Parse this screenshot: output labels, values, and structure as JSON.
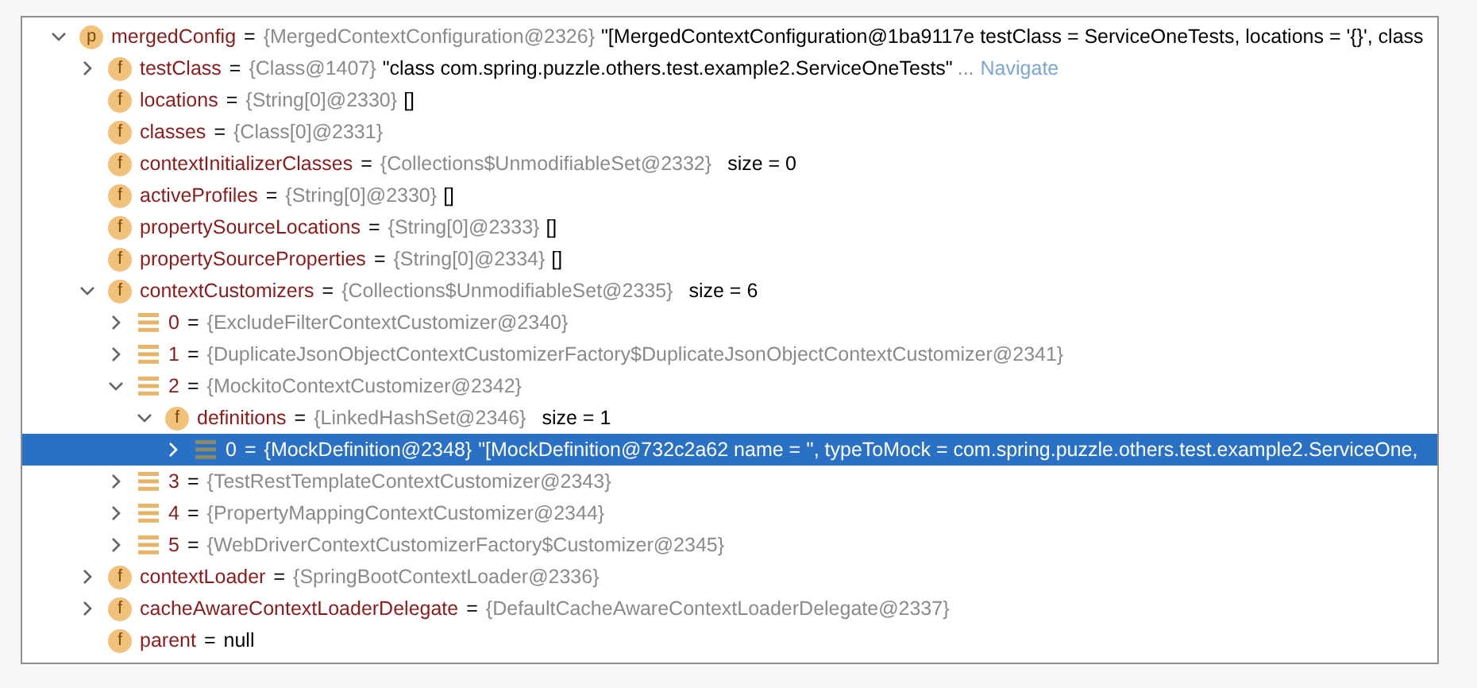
{
  "variables": [
    {
      "kind": "property",
      "badge": "p",
      "name": "mergedConfig",
      "assign": "=",
      "type": "{MergedContextConfiguration@2326}",
      "value": "\"[MergedContextConfiguration@1ba9117e testClass = ServiceOneTests, locations = '{}', class",
      "expanded": true,
      "selected": false,
      "children": [
        {
          "kind": "field",
          "badge": "f",
          "name": "testClass",
          "assign": "=",
          "type": "{Class@1407}",
          "value": "\"class com.spring.puzzle.others.test.example2.ServiceOneTests\"",
          "more": "...",
          "link": "Navigate",
          "expanded": false,
          "selected": false
        },
        {
          "kind": "field",
          "badge": "f",
          "name": "locations",
          "assign": "=",
          "type": "{String[0]@2330}",
          "value": "[]",
          "selected": false
        },
        {
          "kind": "field",
          "badge": "f",
          "name": "classes",
          "assign": "=",
          "type": "{Class[0]@2331}",
          "selected": false
        },
        {
          "kind": "field",
          "badge": "f",
          "name": "contextInitializerClasses",
          "assign": "=",
          "type": "{Collections$UnmodifiableSet@2332}",
          "size": "size = 0",
          "selected": false
        },
        {
          "kind": "field",
          "badge": "f",
          "name": "activeProfiles",
          "assign": "=",
          "type": "{String[0]@2330}",
          "value": "[]",
          "selected": false
        },
        {
          "kind": "field",
          "badge": "f",
          "name": "propertySourceLocations",
          "assign": "=",
          "type": "{String[0]@2333}",
          "value": "[]",
          "selected": false
        },
        {
          "kind": "field",
          "badge": "f",
          "name": "propertySourceProperties",
          "assign": "=",
          "type": "{String[0]@2334}",
          "value": "[]",
          "selected": false
        },
        {
          "kind": "field",
          "badge": "f",
          "name": "contextCustomizers",
          "assign": "=",
          "type": "{Collections$UnmodifiableSet@2335}",
          "size": "size = 6",
          "expanded": true,
          "selected": false,
          "children": [
            {
              "kind": "element",
              "name": "0",
              "assign": "=",
              "type": "{ExcludeFilterContextCustomizer@2340}",
              "expanded": false,
              "selected": false
            },
            {
              "kind": "element",
              "name": "1",
              "assign": "=",
              "type": "{DuplicateJsonObjectContextCustomizerFactory$DuplicateJsonObjectContextCustomizer@2341}",
              "expanded": false,
              "selected": false
            },
            {
              "kind": "element",
              "name": "2",
              "assign": "=",
              "type": "{MockitoContextCustomizer@2342}",
              "expanded": true,
              "selected": false,
              "children": [
                {
                  "kind": "field",
                  "badge": "f",
                  "name": "definitions",
                  "assign": "=",
                  "type": "{LinkedHashSet@2346}",
                  "size": "size = 1",
                  "expanded": true,
                  "selected": false,
                  "children": [
                    {
                      "kind": "element",
                      "name": "0",
                      "assign": "=",
                      "type": "{MockDefinition@2348}",
                      "value": "\"[MockDefinition@732c2a62 name = '', typeToMock = com.spring.puzzle.others.test.example2.ServiceOne,",
                      "expanded": false,
                      "selected": true
                    }
                  ]
                }
              ]
            },
            {
              "kind": "element",
              "name": "3",
              "assign": "=",
              "type": "{TestRestTemplateContextCustomizer@2343}",
              "expanded": false,
              "selected": false
            },
            {
              "kind": "element",
              "name": "4",
              "assign": "=",
              "type": "{PropertyMappingContextCustomizer@2344}",
              "expanded": false,
              "selected": false
            },
            {
              "kind": "element",
              "name": "5",
              "assign": "=",
              "type": "{WebDriverContextCustomizerFactory$Customizer@2345}",
              "expanded": false,
              "selected": false
            }
          ]
        },
        {
          "kind": "field",
          "badge": "f",
          "name": "contextLoader",
          "assign": "=",
          "type": "{SpringBootContextLoader@2336}",
          "expanded": false,
          "selected": false
        },
        {
          "kind": "field",
          "badge": "f",
          "name": "cacheAwareContextLoaderDelegate",
          "assign": "=",
          "type": "{DefaultCacheAwareContextLoaderDelegate@2337}",
          "expanded": false,
          "selected": false
        },
        {
          "kind": "field",
          "badge": "f",
          "name": "parent",
          "assign": "=",
          "value": "null",
          "selected": false
        }
      ]
    }
  ]
}
